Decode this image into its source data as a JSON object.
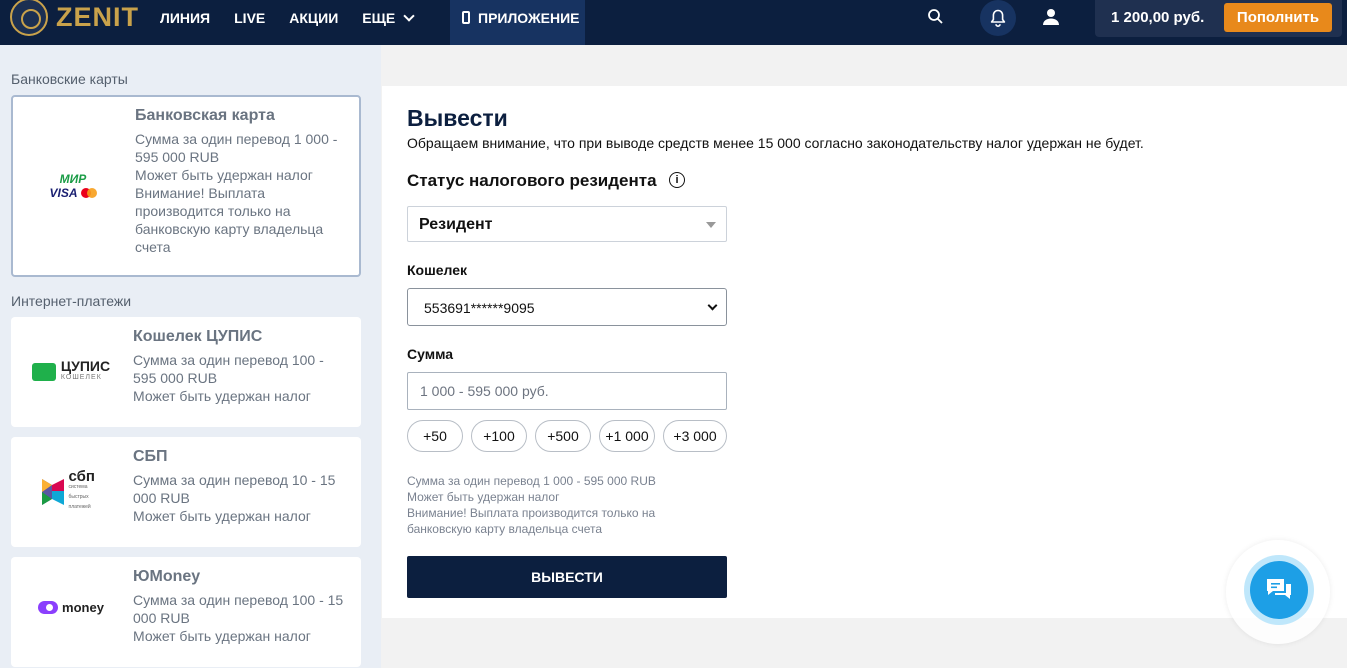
{
  "header": {
    "logo_text": "ZENIT",
    "nav": [
      "ЛИНИЯ",
      "LIVE",
      "АКЦИИ",
      "ЕЩЕ"
    ],
    "app_tab": "ПРИЛОЖЕНИЕ",
    "balance": "1 200,00 руб.",
    "topup_label": "Пополнить",
    "icons": [
      "search-icon",
      "bell-icon",
      "user-icon"
    ]
  },
  "sidebar": {
    "bank_section_title": "Банковские карты",
    "internet_section_title": "Интернет-платежи",
    "methods": [
      {
        "title": "Банковская карта",
        "desc": "Сумма за один перевод 1 000 -\n595 000 RUB\nМожет быть удержан налог\nВнимание! Выплата\nпроизводится только на\nбанковскую карту владельца\nсчета",
        "logo_line1": "МИР",
        "logo_line2": "VISA",
        "selected": true
      },
      {
        "title": "Кошелек ЦУПИС",
        "desc": "Сумма за один перевод 100 -\n595 000 RUB\nМожет быть удержан налог",
        "logo_text": "ЦУПИС",
        "logo_sub": "КОШЕЛЕК"
      },
      {
        "title": "СБП",
        "desc": "Сумма за один перевод 10 - 15\n000 RUB\nМожет быть удержан налог",
        "logo_text": "сбп",
        "logo_sub": "система быстрых платежей"
      },
      {
        "title": "ЮMoney",
        "desc": "Сумма за один перевод 100 - 15\n000 RUB\nМожет быть удержан налог",
        "logo_text": "money"
      }
    ]
  },
  "main": {
    "title": "Вывести",
    "notice": "Обращаем внимание, что при выводе средств менее 15 000 согласно законодательству налог удержан не будет.",
    "tax_status_title": "Статус налогового резидента",
    "tax_status_value": "Резидент",
    "wallet_label": "Кошелек",
    "wallet_value": "553691******9095",
    "amount_label": "Сумма",
    "amount_placeholder": "1 000 - 595 000 руб.",
    "quick_amounts": [
      "+50",
      "+100",
      "+500",
      "+1 000",
      "+3 000"
    ],
    "hint": "Сумма за один перевод 1 000 - 595 000 RUB\nМожет быть удержан налог\nВнимание! Выплата производится только на\nбанковскую карту владельца счета",
    "submit_label": "ВЫВЕСТИ"
  },
  "colors": {
    "header_bg": "#0c1f3f",
    "accent": "#e8891b",
    "brand_gold": "#c9a24b",
    "chat": "#1d9fe6"
  }
}
